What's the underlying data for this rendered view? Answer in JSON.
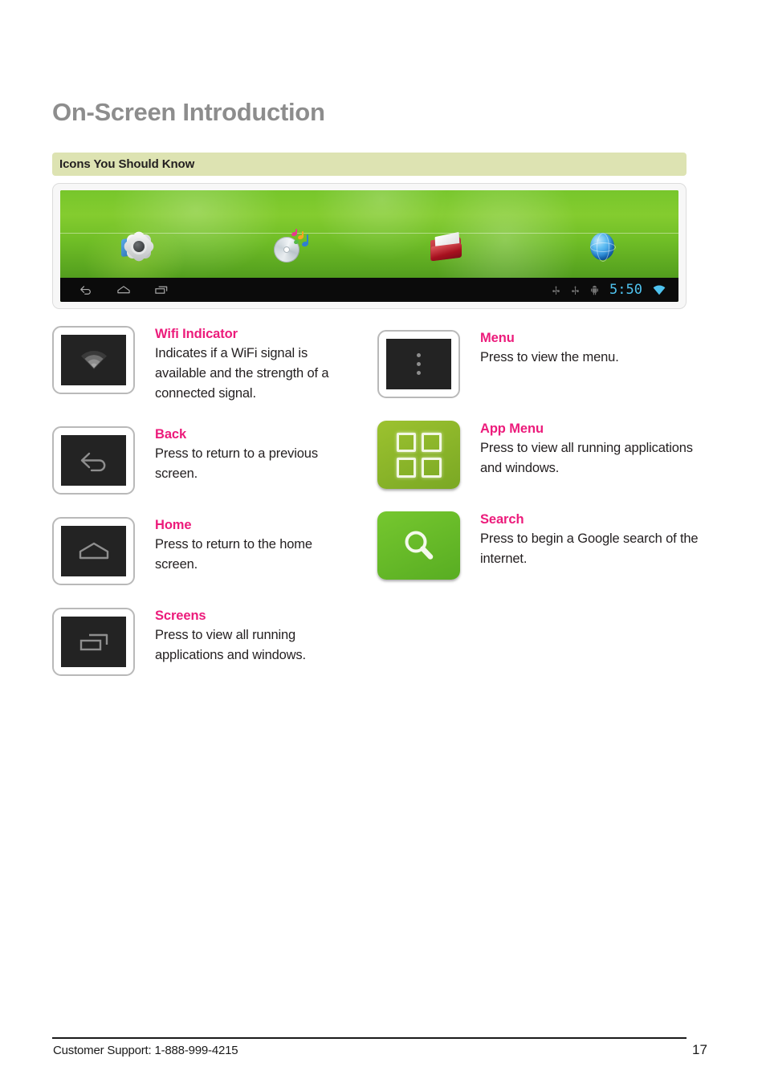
{
  "page": {
    "title": "On-Screen Introduction",
    "section_header": "Icons You Should Know",
    "accent_pink": "#ec1b7b",
    "section_bar_color": "#dde3b2"
  },
  "tablet_screenshot": {
    "wallpaper_color": "#6cc125",
    "apps": [
      {
        "name": "settings-app-icon",
        "label": "Settings"
      },
      {
        "name": "music-app-icon",
        "label": "Music"
      },
      {
        "name": "file-manager-app-icon",
        "label": "File Manager"
      },
      {
        "name": "browser-app-icon",
        "label": "Browser"
      }
    ],
    "navbar": {
      "left_icons": [
        "back-icon",
        "home-icon",
        "recents-icon"
      ],
      "status_icons": [
        "usb-icon",
        "usb-icon",
        "android-debug-icon"
      ],
      "clock": "5:50",
      "clock_color": "#4fc3ef",
      "wifi_icon": "wifi-icon"
    }
  },
  "legend": {
    "left_column": [
      {
        "icon": "wifi-indicator-icon",
        "style": "dark",
        "title": "Wifi Indicator",
        "description": "Indicates if a WiFi signal is available and the strength of a connected signal."
      },
      {
        "icon": "back-icon",
        "style": "dark",
        "title": "Back",
        "description": "Press to return to a previous screen."
      },
      {
        "icon": "home-icon",
        "style": "dark",
        "title": "Home",
        "description": "Press to return to the home screen."
      },
      {
        "icon": "screens-icon",
        "style": "dark",
        "title": "Screens",
        "description": "Press to view all running applications and windows."
      }
    ],
    "right_column": [
      {
        "icon": "menu-icon",
        "style": "dark",
        "title": "Menu",
        "description": "Press to view the menu."
      },
      {
        "icon": "app-menu-icon",
        "style": "green",
        "title": "App Menu",
        "description": "Press to view all running applications and windows."
      },
      {
        "icon": "search-icon",
        "style": "green",
        "title": "Search",
        "description": "Press to begin a Google search of the internet."
      }
    ]
  },
  "footer": {
    "support": "Customer Support: 1-888-999-4215",
    "page_number": "17"
  }
}
